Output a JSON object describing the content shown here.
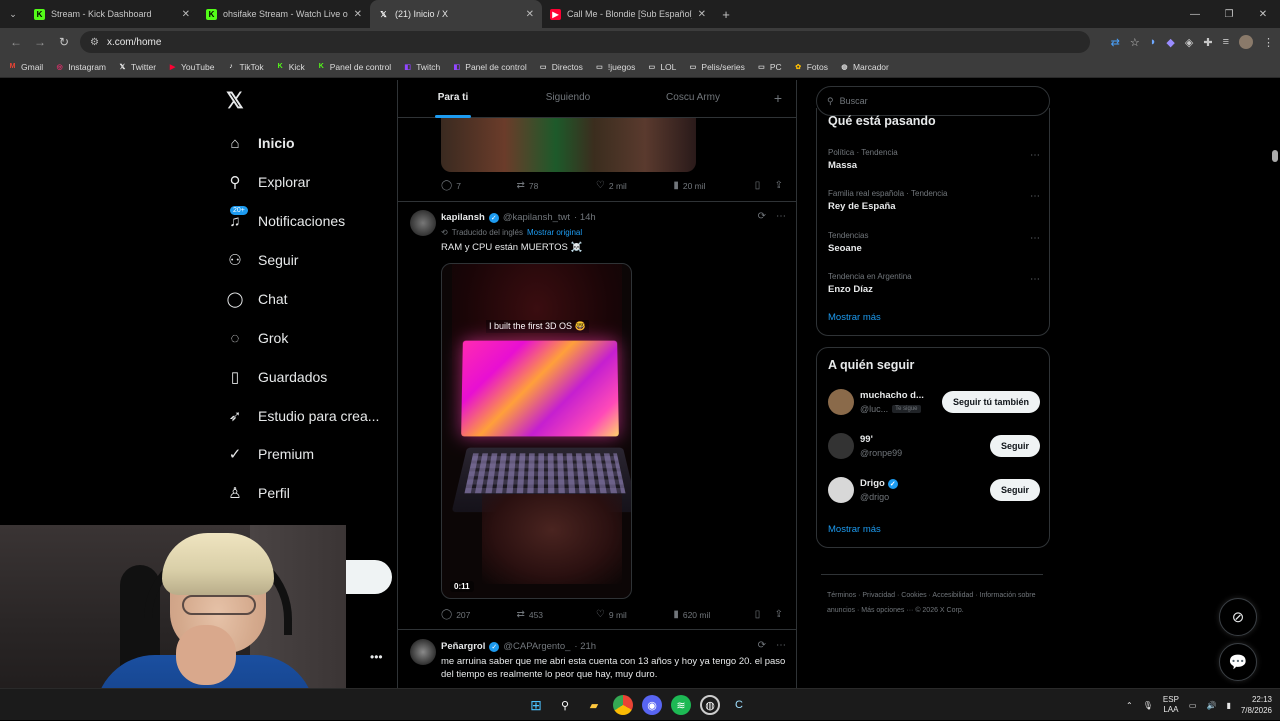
{
  "browser": {
    "tabs": [
      {
        "title": "Stream - Kick Dashboard",
        "icon": "kick-icon",
        "color": "#53fc18"
      },
      {
        "title": "ohsifake Stream - Watch Live o",
        "icon": "kick-icon",
        "color": "#53fc18"
      },
      {
        "title": "(21) Inicio / X",
        "icon": "x-icon",
        "color": "#ffffff"
      },
      {
        "title": "Call Me - Blondie [Sub Español]",
        "icon": "youtube-icon",
        "color": "#ff0033"
      }
    ],
    "url": "x.com/home",
    "bookmarks": [
      {
        "label": "Gmail",
        "icon": "gmail-icon",
        "color": "#ea4335"
      },
      {
        "label": "Instagram",
        "icon": "instagram-icon",
        "color": "#e1306c"
      },
      {
        "label": "Twitter",
        "icon": "x-icon",
        "color": "#ffffff"
      },
      {
        "label": "YouTube",
        "icon": "youtube-icon",
        "color": "#ff0033"
      },
      {
        "label": "TikTok",
        "icon": "tiktok-icon",
        "color": "#ffffff"
      },
      {
        "label": "Kick",
        "icon": "kick-icon",
        "color": "#53fc18"
      },
      {
        "label": "Panel de control",
        "icon": "kick-icon",
        "color": "#53fc18"
      },
      {
        "label": "Twitch",
        "icon": "twitch-icon",
        "color": "#9146ff"
      },
      {
        "label": "Panel de control",
        "icon": "twitch-icon",
        "color": "#9146ff"
      },
      {
        "label": "Directos",
        "icon": "folder-icon",
        "color": "#dcdcdc"
      },
      {
        "label": "!juegos",
        "icon": "folder-icon",
        "color": "#dcdcdc"
      },
      {
        "label": "LOL",
        "icon": "folder-icon",
        "color": "#dcdcdc"
      },
      {
        "label": "Pelis/series",
        "icon": "folder-icon",
        "color": "#dcdcdc"
      },
      {
        "label": "PC",
        "icon": "folder-icon",
        "color": "#dcdcdc"
      },
      {
        "label": "Fotos",
        "icon": "photos-icon",
        "color": "#fbbc04"
      },
      {
        "label": "Marcador",
        "icon": "globe-icon",
        "color": "#dcdcdc"
      }
    ]
  },
  "nav": {
    "items": [
      {
        "label": "Inicio",
        "icon": "home-icon",
        "glyph": "⌂"
      },
      {
        "label": "Explorar",
        "icon": "search-icon",
        "glyph": "⚲"
      },
      {
        "label": "Notificaciones",
        "icon": "bell-icon",
        "glyph": "♫"
      },
      {
        "label": "Seguir",
        "icon": "follow-icon",
        "glyph": "⚇"
      },
      {
        "label": "Chat",
        "icon": "chat-icon",
        "glyph": "◯"
      },
      {
        "label": "Grok",
        "icon": "grok-icon",
        "glyph": "◌"
      },
      {
        "label": "Guardados",
        "icon": "bookmark-icon",
        "glyph": "▯"
      },
      {
        "label": "Estudio para crea...",
        "icon": "rocket-icon",
        "glyph": "➶"
      },
      {
        "label": "Premium",
        "icon": "premium-icon",
        "glyph": "✓"
      },
      {
        "label": "Perfil",
        "icon": "person-icon",
        "glyph": "♙"
      }
    ],
    "notif_badge": "20+"
  },
  "feed": {
    "tabs": [
      "Para ti",
      "Siguiendo",
      "Coscu Army"
    ],
    "top_actions": {
      "replies": "7",
      "reposts": "78",
      "likes": "2 mil",
      "views": "20 mil"
    },
    "tweet1": {
      "name": "kapilansh",
      "handle": "@kapilansh_twt",
      "time": "· 14h",
      "translated_label": "Traducido del inglés",
      "show_original": "Mostrar original",
      "text": "RAM y CPU están MUERTOS ☠️",
      "video_caption": "I built the first 3D OS 🤓",
      "video_time": "0:11",
      "actions": {
        "replies": "207",
        "reposts": "453",
        "likes": "9 mil",
        "views": "620 mil"
      }
    },
    "tweet2": {
      "name": "Peñargrol",
      "handle": "@CAPArgento_",
      "time": "· 21h",
      "text": "me arruina saber que me abri esta cuenta con 13 años y hoy ya tengo 20. el paso del tiempo es realmente lo peor que hay, muy duro."
    }
  },
  "sidebar": {
    "search_placeholder": "Buscar",
    "trends_title": "Qué está pasando",
    "trends": [
      {
        "category": "Política · Tendencia",
        "title": "Massa"
      },
      {
        "category": "Familia real española · Tendencia",
        "title": "Rey de España"
      },
      {
        "category": "Tendencias",
        "title": "Seoane"
      },
      {
        "category": "Tendencia en Argentina",
        "title": "Enzo Díaz"
      }
    ],
    "show_more": "Mostrar más",
    "follow_title": "A quién seguir",
    "follow": [
      {
        "name": "muchacho d...",
        "handle": "@luc...",
        "tag": "Te sigue",
        "button": "Seguir tú también",
        "verified": false,
        "color": "#8a6a4a"
      },
      {
        "name": "99'",
        "handle": "@ronpe99",
        "tag": "",
        "button": "Seguir",
        "verified": false,
        "color": "#333333"
      },
      {
        "name": "Drigo",
        "handle": "@drigo",
        "tag": "",
        "button": "Seguir",
        "verified": true,
        "color": "#d8d8d8"
      }
    ],
    "footer": "Términos  ·  Privacidad  ·  Cookies  ·  Accesibilidad  ·  Información sobre anuncios  ·  Más opciones ···  © 2026 X Corp."
  },
  "taskbar": {
    "lang1": "ESP",
    "lang2": "LAA",
    "time": "22:13",
    "date": "7/8/2026"
  }
}
